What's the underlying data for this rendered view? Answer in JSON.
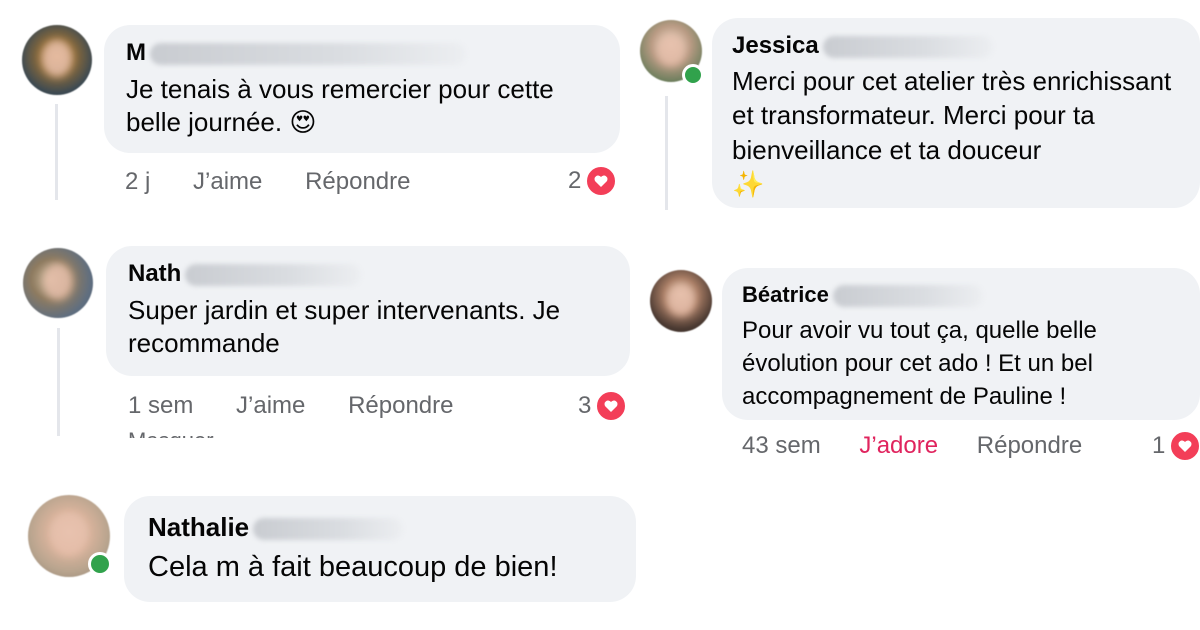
{
  "comments": [
    {
      "author": "M",
      "text": "Je tenais à vous remercier pour cette belle journée.",
      "emoji": "😍",
      "time": "2 j",
      "like_label": "J’aime",
      "reply_label": "Répondre",
      "reaction_count": "2",
      "reaction_icon": "heart-icon"
    },
    {
      "author": "Jessica",
      "text": "Merci pour cet atelier très enrichissant et transformateur. Merci pour ta bienveillance et ta douceur",
      "emoji": "✨",
      "online": true
    },
    {
      "author": "Nath",
      "text": "Super jardin et super intervenants. Je recommande",
      "time": "1 sem",
      "like_label": "J’aime",
      "reply_label": "Répondre",
      "reaction_count": "3",
      "reaction_icon": "heart-icon",
      "cutoff_label": "Masquer"
    },
    {
      "author": "Béatrice",
      "text": "Pour avoir vu tout ça, quelle belle évolution pour cet ado ! Et un bel accompagnement de Pauline !",
      "time": "43 sem",
      "like_label": "J’adore",
      "reply_label": "Répondre",
      "reaction_count": "1",
      "reaction_icon": "heart-icon"
    },
    {
      "author": "Nathalie",
      "text": "Cela m à fait beaucoup de bien!",
      "online": true
    }
  ],
  "colors": {
    "bubble": "#f0f2f5",
    "meta": "#65676b",
    "love_reaction": "#f33e58",
    "adore_label": "#e0245e",
    "online": "#31a24c"
  }
}
